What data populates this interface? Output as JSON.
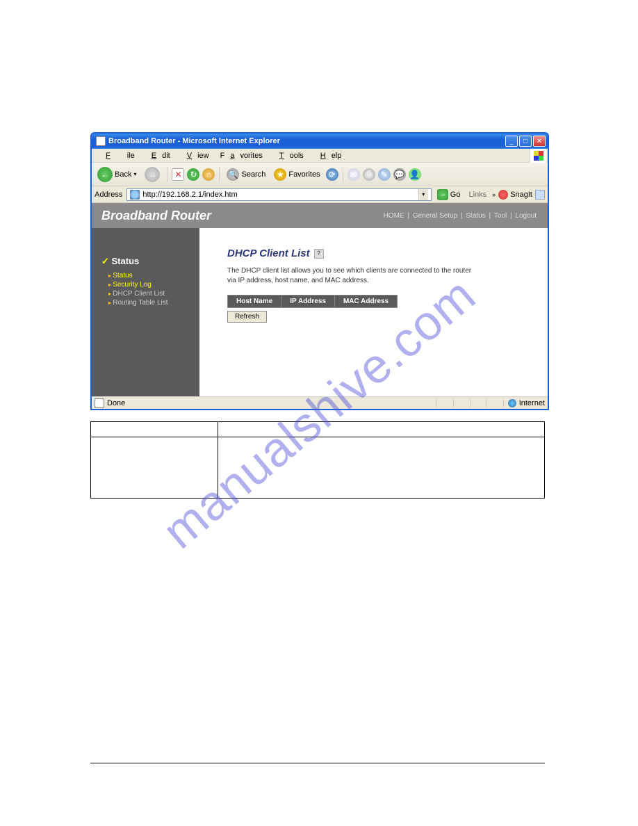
{
  "window": {
    "title": "Broadband Router - Microsoft Internet Explorer"
  },
  "menubar": {
    "file": "File",
    "edit": "Edit",
    "view": "View",
    "favorites": "Favorites",
    "tools": "Tools",
    "help": "Help"
  },
  "toolbar": {
    "back": "Back",
    "search": "Search",
    "favorites": "Favorites"
  },
  "addressbar": {
    "label": "Address",
    "url": "http://192.168.2.1/index.htm",
    "go": "Go",
    "links": "Links",
    "snagit": "SnagIt"
  },
  "router": {
    "brand": "Broadband Router",
    "nav": {
      "home": "HOME",
      "general": "General Setup",
      "status": "Status",
      "tool": "Tool",
      "logout": "Logout"
    },
    "sidebar": {
      "title": "Status",
      "items": [
        {
          "label": "Status",
          "active": true
        },
        {
          "label": "Security Log",
          "active": true
        },
        {
          "label": "DHCP Client List",
          "active": false
        },
        {
          "label": "Routing Table List",
          "active": false
        }
      ]
    },
    "main": {
      "title": "DHCP Client List",
      "desc": "The DHCP client list allows you to see which clients are connected to the router via IP address, host name, and MAC address.",
      "cols": {
        "hostname": "Host Name",
        "ip": "IP Address",
        "mac": "MAC Address"
      },
      "refresh": "Refresh"
    }
  },
  "statusbar": {
    "done": "Done",
    "zone": "Internet"
  },
  "watermark": "manualshive.com"
}
